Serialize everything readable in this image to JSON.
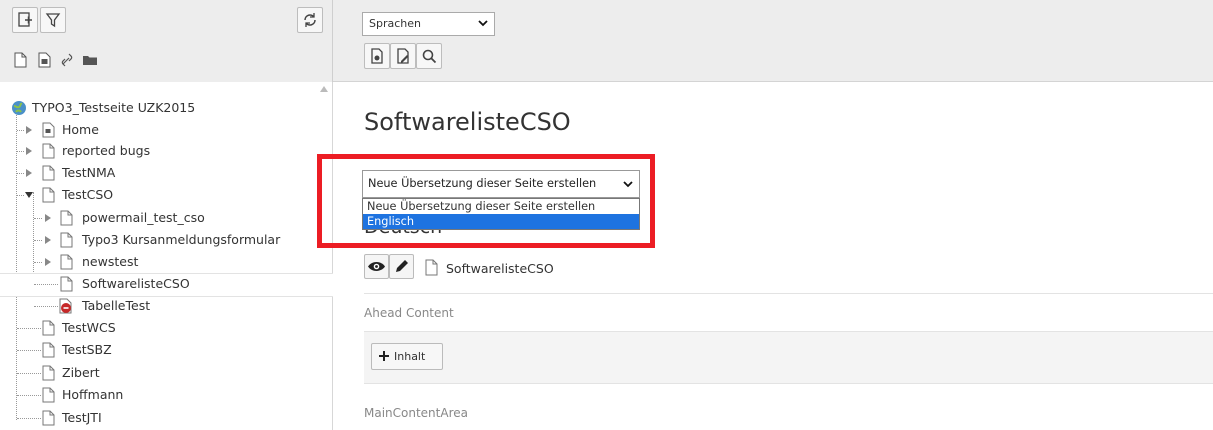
{
  "tree": {
    "root_label": "TYPO3_Testseite UZK2015",
    "items": [
      {
        "label": "Home"
      },
      {
        "label": "reported bugs"
      },
      {
        "label": "TestNMA"
      },
      {
        "label": "TestCSO"
      },
      {
        "label": "powermail_test_cso"
      },
      {
        "label": "Typo3 Kursanmeldungsformular"
      },
      {
        "label": "newstest"
      },
      {
        "label": "SoftwarelisteCSO"
      },
      {
        "label": "TabelleTest"
      },
      {
        "label": "TestWCS"
      },
      {
        "label": "TestSBZ"
      },
      {
        "label": "Zibert"
      },
      {
        "label": "Hoffmann"
      },
      {
        "label": "TestJTI"
      }
    ]
  },
  "doc_toolbar": {
    "language_select_value": "Sprachen"
  },
  "page": {
    "title": "SoftwarelisteCSO",
    "translation_select_value": "Neue Übersetzung dieser Seite erstellen",
    "translation_options": [
      "Neue Übersetzung dieser Seite erstellen",
      "Englisch"
    ],
    "language_heading": "Deutsch",
    "page_ref_label": "SoftwarelisteCSO",
    "sections": {
      "ahead": "Ahead Content",
      "add_content_label": "Inhalt",
      "main": "MainContentArea"
    }
  },
  "colors": {
    "highlight": "#1e73e0",
    "annotation_box": "#ec1d24"
  }
}
